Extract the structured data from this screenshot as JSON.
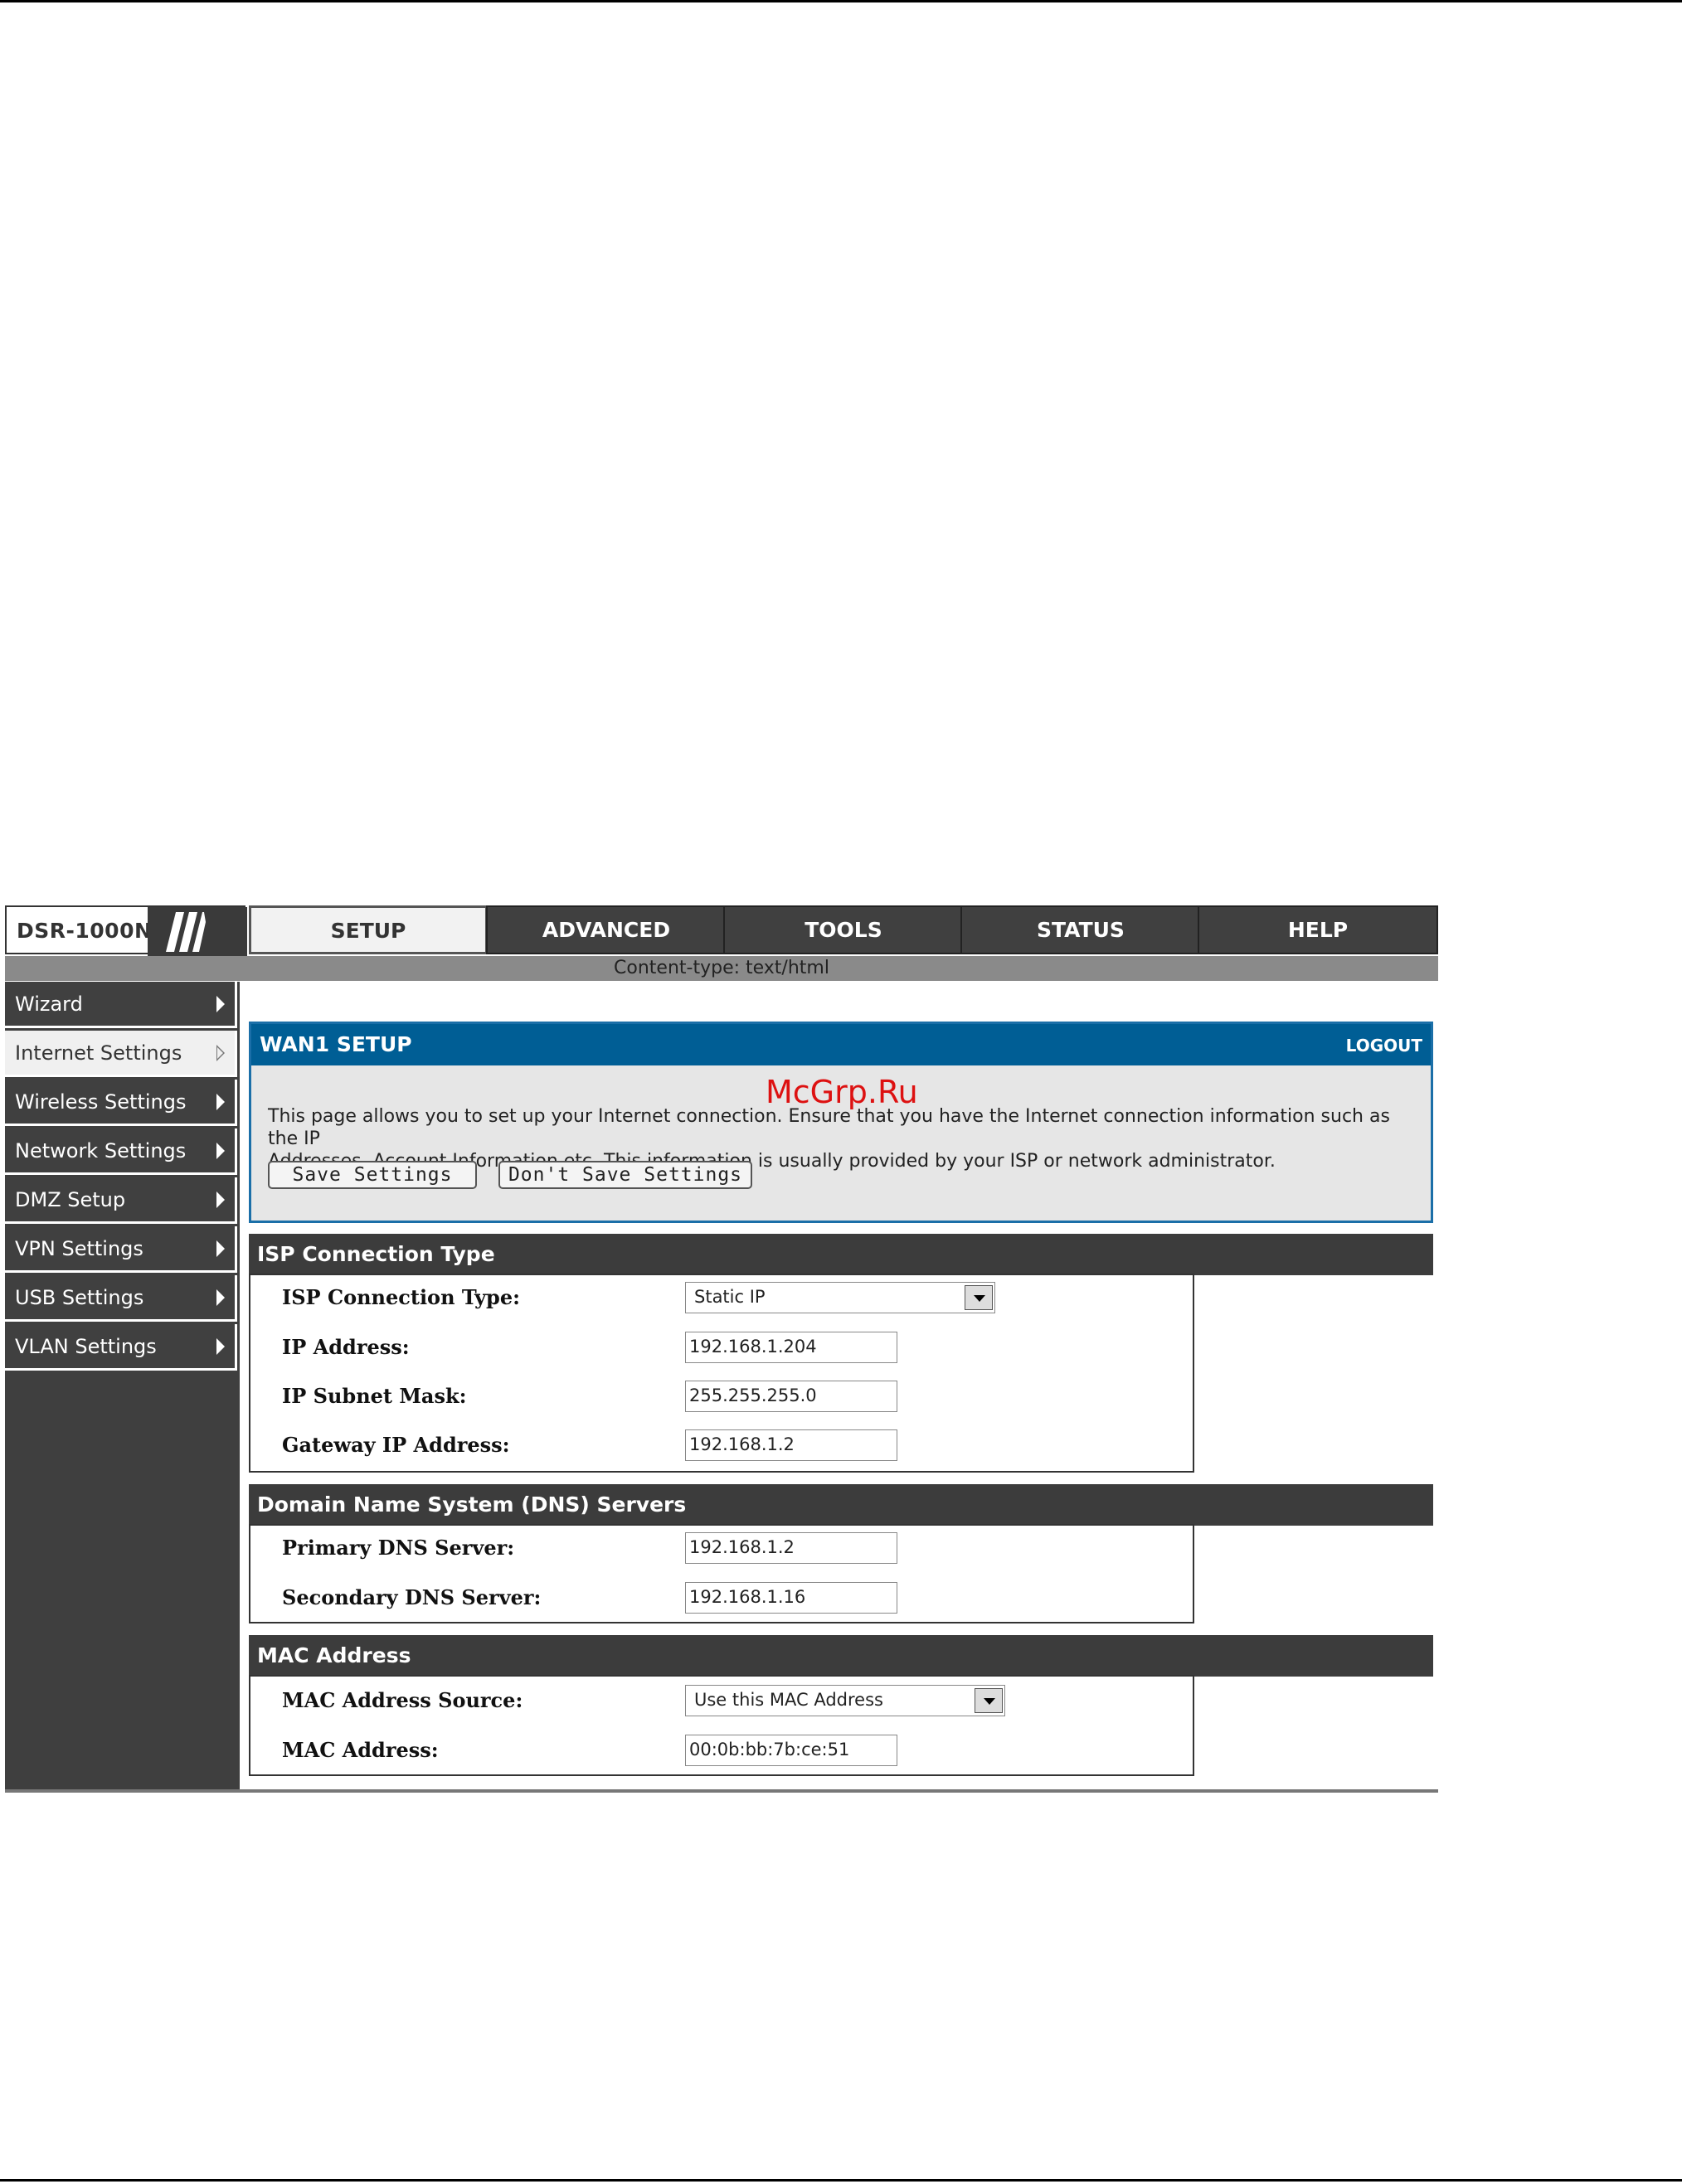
{
  "product": "DSR-1000N",
  "nav_tabs": [
    {
      "label": "SETUP",
      "active": true
    },
    {
      "label": "ADVANCED",
      "active": false
    },
    {
      "label": "TOOLS",
      "active": false
    },
    {
      "label": "STATUS",
      "active": false
    },
    {
      "label": "HELP",
      "active": false
    }
  ],
  "content_type_bar": "Content-type: text/html",
  "sidebar": {
    "items": [
      {
        "label": "Wizard"
      },
      {
        "label": "Internet Settings",
        "active": true
      },
      {
        "label": "Wireless Settings"
      },
      {
        "label": "Network Settings"
      },
      {
        "label": "DMZ Setup"
      },
      {
        "label": "VPN Settings"
      },
      {
        "label": "USB Settings"
      },
      {
        "label": "VLAN Settings"
      }
    ]
  },
  "wan_panel": {
    "title": "WAN1 SETUP",
    "logout": "LOGOUT",
    "watermark": "McGrp.Ru",
    "description_line1": "This page allows you to set up your Internet connection. Ensure that you have the Internet connection information such as the IP",
    "description_line2": "Addresses, Account Information etc. This information is usually provided by your ISP or network administrator.",
    "save_button": "Save Settings",
    "dont_save_button": "Don't Save Settings"
  },
  "isp_section": {
    "title": "ISP Connection Type",
    "connection_type_label": "ISP Connection Type:",
    "connection_type_value": "Static IP",
    "ip_label": "IP Address:",
    "ip_value": "192.168.1.204",
    "subnet_label": "IP Subnet Mask:",
    "subnet_value": "255.255.255.0",
    "gateway_label": "Gateway IP Address:",
    "gateway_value": "192.168.1.2"
  },
  "dns_section": {
    "title": "Domain Name System (DNS) Servers",
    "primary_label": "Primary DNS Server:",
    "primary_value": "192.168.1.2",
    "secondary_label": "Secondary DNS Server:",
    "secondary_value": "192.168.1.16"
  },
  "mac_section": {
    "title": "MAC Address",
    "source_label": "MAC Address Source:",
    "source_value": "Use this MAC Address",
    "mac_label": "MAC Address:",
    "mac_value": "00:0b:bb:7b:ce:51"
  },
  "colors": {
    "header_blue": "#005e95",
    "dark_gray": "#404040",
    "watermark_red": "#dd1111"
  }
}
